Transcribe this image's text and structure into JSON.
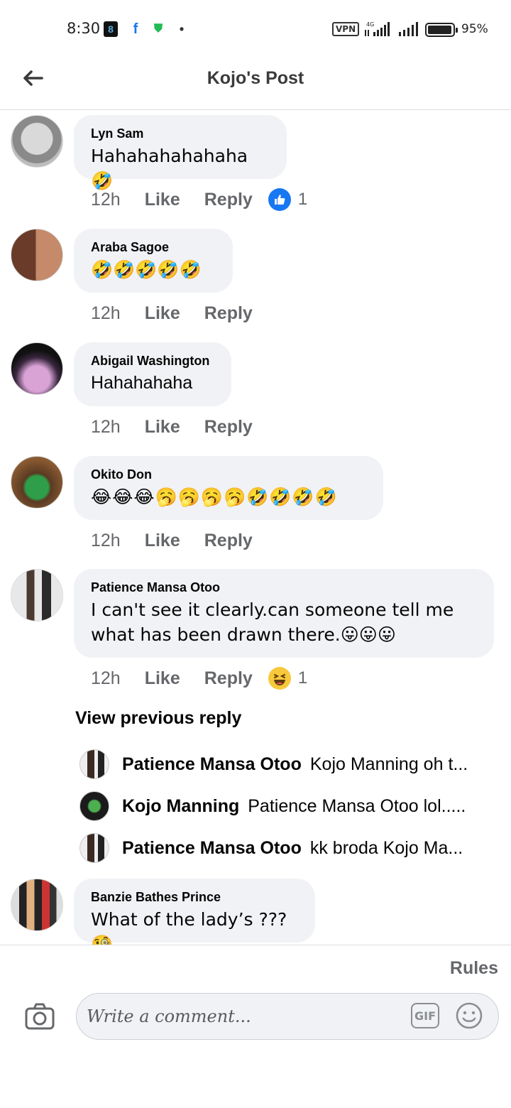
{
  "status_bar": {
    "time": "8:30",
    "vpn": "VPN",
    "network": "4G",
    "battery": "95%",
    "notification_icons": [
      "app-icon",
      "facebook-icon",
      "shield-app-icon",
      "dot-icon"
    ]
  },
  "header": {
    "title": "Kojo's Post"
  },
  "comments": [
    {
      "name": "Lyn Sam",
      "text": "Hahahahahahaha 🤣",
      "time": "12h",
      "like": "Like",
      "reply": "Reply",
      "reaction": {
        "type": "like",
        "count": "1"
      }
    },
    {
      "name": "Araba Sagoe",
      "text": "🤣🤣🤣🤣🤣",
      "time": "12h",
      "like": "Like",
      "reply": "Reply"
    },
    {
      "name": "Abigail Washington",
      "text": "Hahahahaha",
      "time": "12h",
      "like": "Like",
      "reply": "Reply"
    },
    {
      "name": "Okito Don",
      "text": "😂😂😂🥱🥱🥱🥱🤣🤣🤣🤣",
      "time": "12h",
      "like": "Like",
      "reply": "Reply"
    },
    {
      "name": "Patience Mansa Otoo",
      "text": "I can't see it clearly.can someone tell me what has been drawn there.😛😛😛",
      "time": "12h",
      "like": "Like",
      "reply": "Reply",
      "reaction": {
        "type": "haha",
        "count": "1"
      }
    },
    {
      "name": "Banzie Bathes Prince",
      "text": "What of the lady’s ???🧐"
    }
  ],
  "view_previous_reply": "View previous reply",
  "replies": [
    {
      "name": "Patience Mansa Otoo",
      "text": "Kojo Manning oh t..."
    },
    {
      "name": "Kojo Manning",
      "text": "Patience Mansa Otoo lol....."
    },
    {
      "name": "Patience Mansa Otoo",
      "text": "kk broda Kojo Ma..."
    }
  ],
  "composer": {
    "rules": "Rules",
    "placeholder": "Write a comment...",
    "gif": "GIF"
  },
  "colors": {
    "bubble": "#f0f2f5",
    "meta_text": "#65676b",
    "like_blue": "#1877f2",
    "haha_yellow": "#f7c83a"
  }
}
